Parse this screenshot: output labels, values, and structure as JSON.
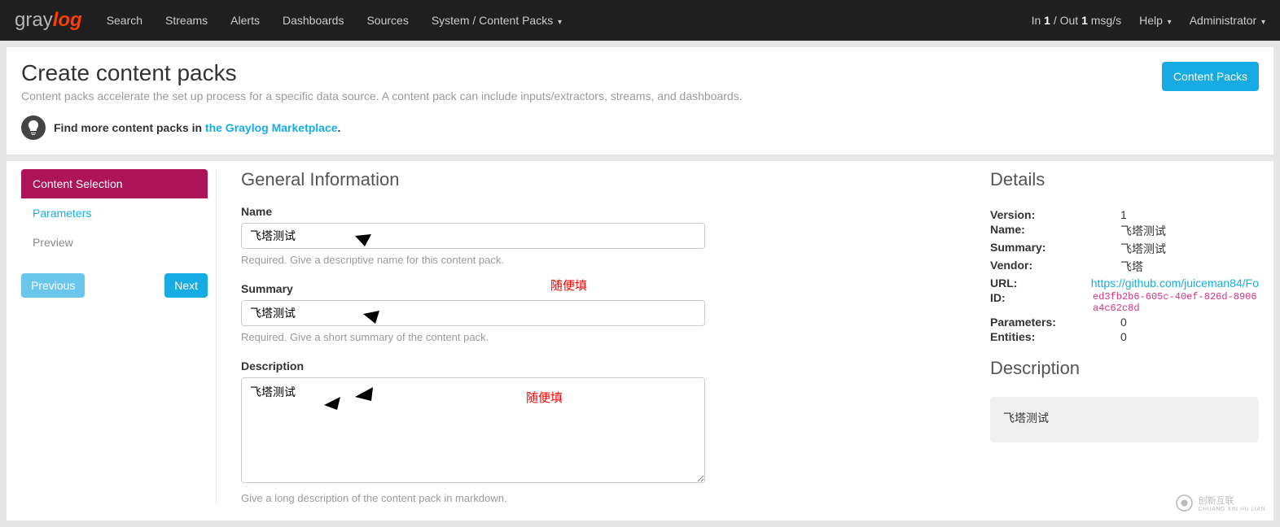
{
  "nav": {
    "items": [
      "Search",
      "Streams",
      "Alerts",
      "Dashboards",
      "Sources",
      "System / Content Packs"
    ],
    "status_prefix": "In ",
    "status_in": "1",
    "status_mid": " / Out ",
    "status_out": "1",
    "status_suffix": " msg/s",
    "help": "Help",
    "admin": "Administrator"
  },
  "header": {
    "title": "Create content packs",
    "subtitle": "Content packs accelerate the set up process for a specific data source. A content pack can include inputs/extractors, streams, and dashboards.",
    "btn_content_packs": "Content Packs",
    "info_prefix": "Find more content packs in ",
    "info_link": "the Graylog Marketplace",
    "info_period": "."
  },
  "wizard": {
    "steps": [
      "Content Selection",
      "Parameters",
      "Preview"
    ],
    "prev": "Previous",
    "next": "Next"
  },
  "form": {
    "section_title": "General Information",
    "name_label": "Name",
    "name_value": "飞塔测试",
    "name_help": "Required. Give a descriptive name for this content pack.",
    "summary_label": "Summary",
    "summary_value": "飞塔测试",
    "summary_help": "Required. Give a short summary of the content pack.",
    "description_label": "Description",
    "description_value": "飞塔测试",
    "description_help": "Give a long description of the content pack in markdown."
  },
  "annotations": {
    "label1": "随便填",
    "label2": "随便填"
  },
  "details": {
    "title": "Details",
    "rows": {
      "version_k": "Version:",
      "version_v": "1",
      "name_k": "Name:",
      "name_v": "飞塔测试",
      "summary_k": "Summary:",
      "summary_v": "飞塔测试",
      "vendor_k": "Vendor:",
      "vendor_v": "飞塔",
      "url_k": "URL:",
      "url_v": "https://github.com/juiceman84/Fo",
      "id_k": "ID:",
      "id_v": "ed3fb2b6-605c-40ef-826d-8906a4c62c8d",
      "params_k": "Parameters:",
      "params_v": "0",
      "entities_k": "Entities:",
      "entities_v": "0"
    },
    "desc_title": "Description",
    "desc_value": "飞塔测试"
  },
  "watermark": {
    "brand": "创新互联",
    "sub": "CHUANG XIN HU LIAN"
  }
}
